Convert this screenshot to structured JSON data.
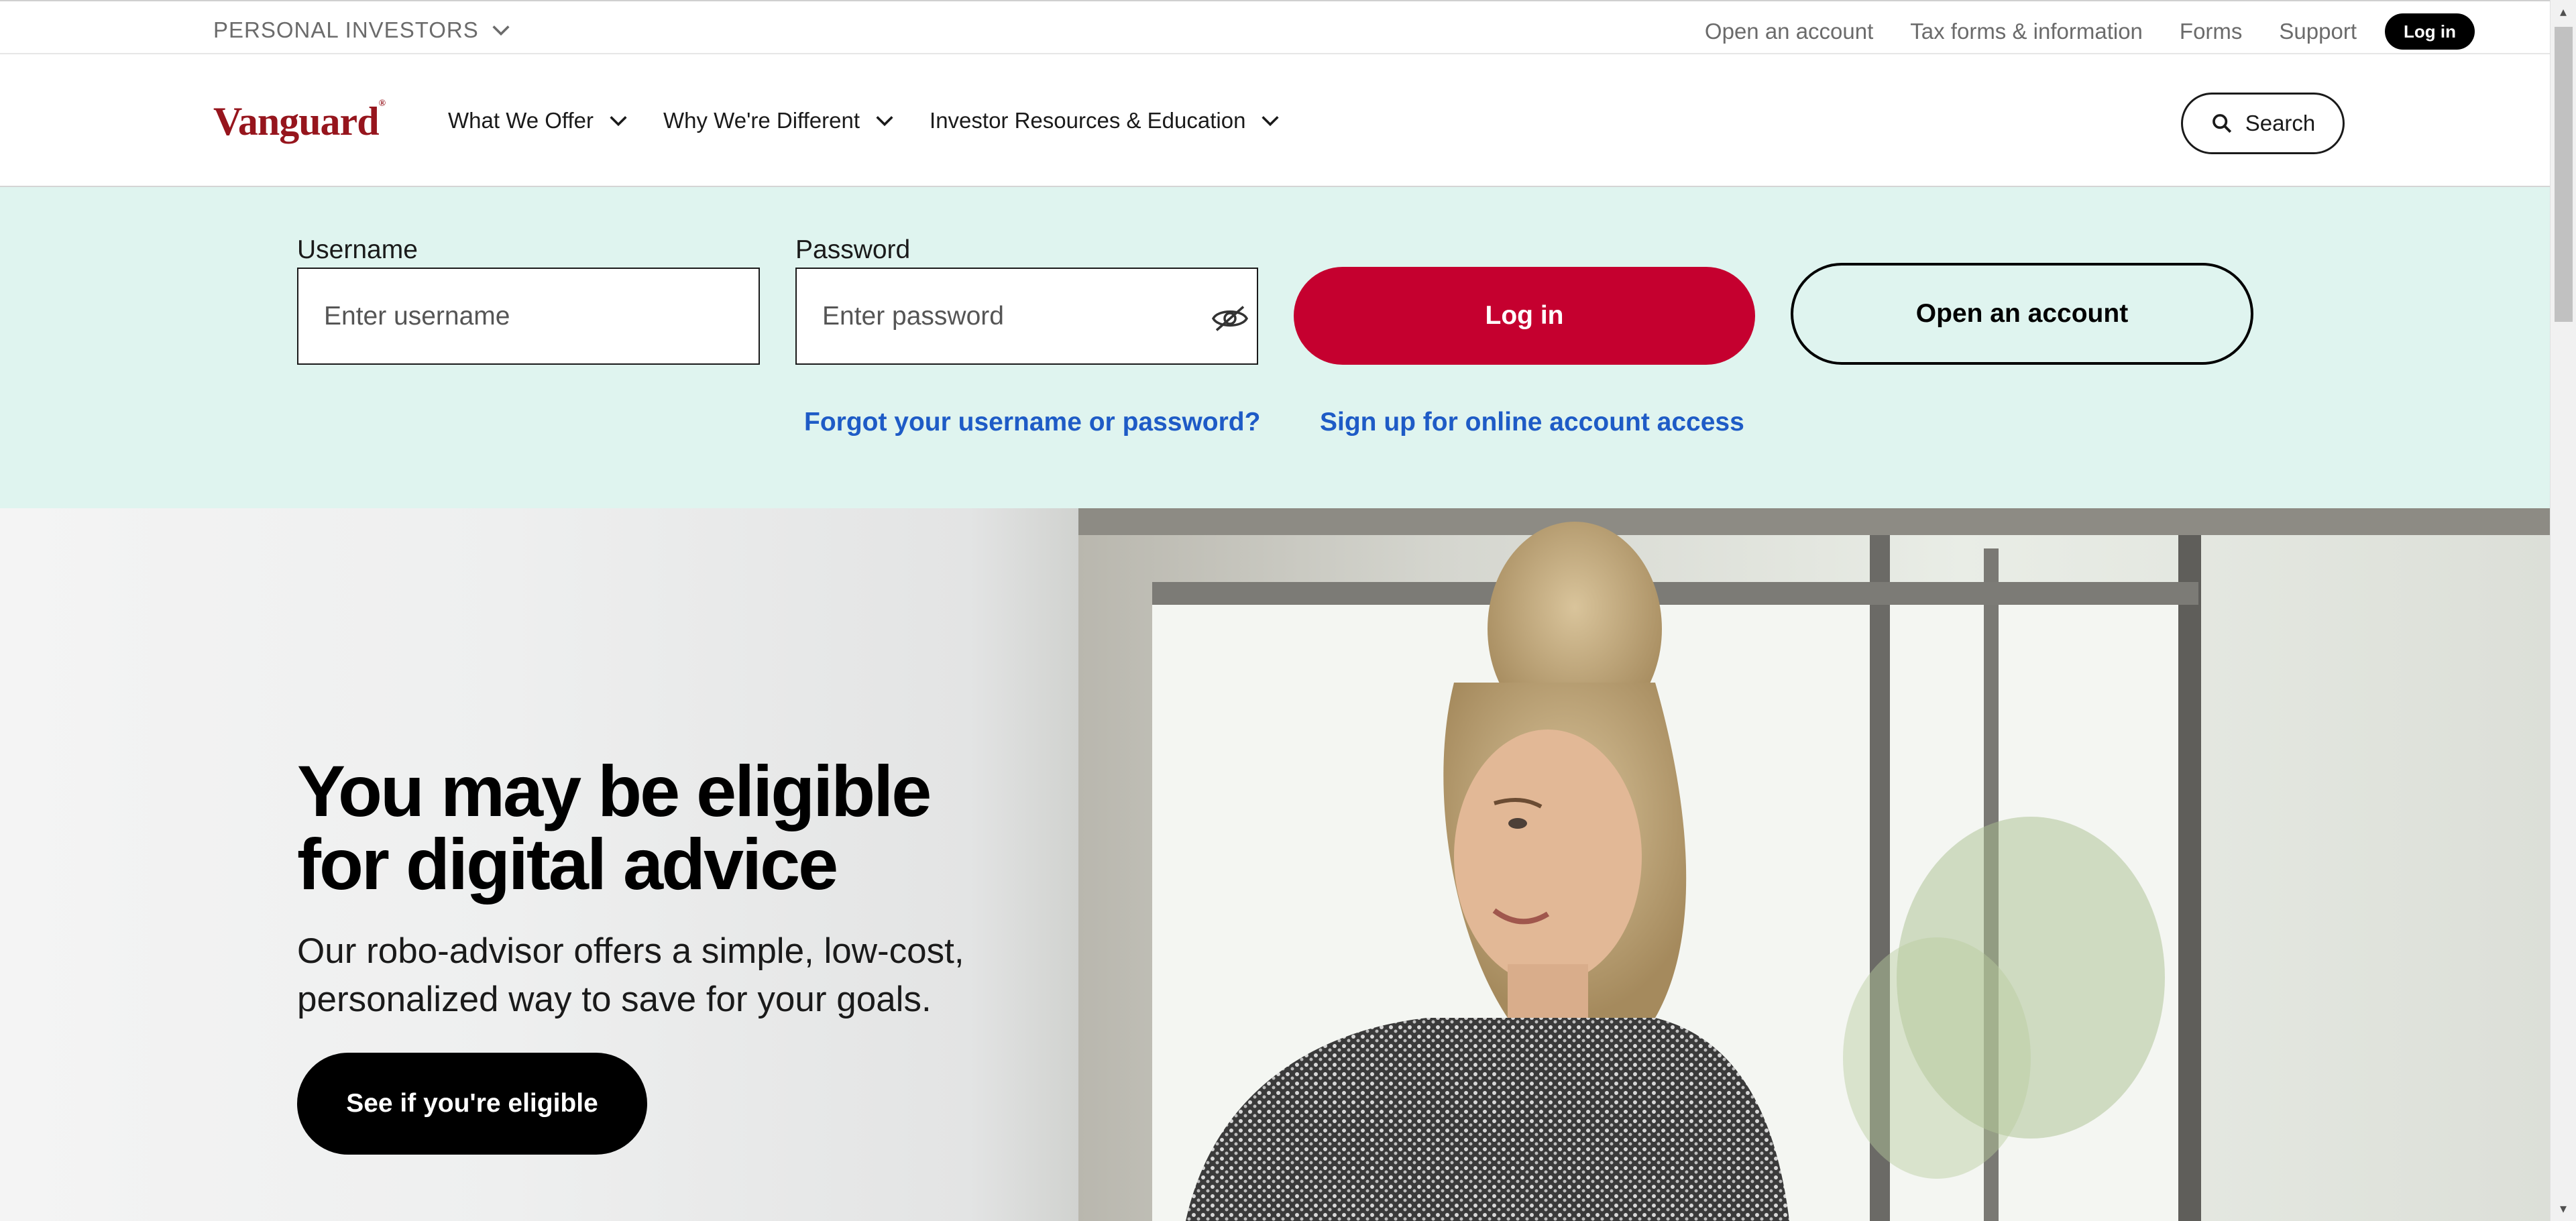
{
  "utility_bar": {
    "audience": "PERSONAL INVESTORS",
    "links": [
      "Open an account",
      "Tax forms & information",
      "Forms",
      "Support"
    ],
    "login_label": "Log in"
  },
  "header": {
    "logo": "Vanguard",
    "nav": [
      "What We Offer",
      "Why We're Different",
      "Investor Resources & Education"
    ],
    "search_label": "Search"
  },
  "login": {
    "username_label": "Username",
    "username_placeholder": "Enter username",
    "password_label": "Password",
    "password_placeholder": "Enter password",
    "login_button": "Log in",
    "open_account_button": "Open an account",
    "forgot_link": "Forgot your username or password?",
    "signup_link": "Sign up for online account access"
  },
  "hero": {
    "title": "You may be eligible for digital advice",
    "subtitle": "Our robo-advisor offers a simple, low-cost, personalized way to save for your goals.",
    "cta": "See if you're eligible"
  },
  "colors": {
    "brand_red": "#96151d",
    "login_red": "#c5002f",
    "band_mint": "#dff4ef",
    "link_blue": "#1e5bc6"
  }
}
